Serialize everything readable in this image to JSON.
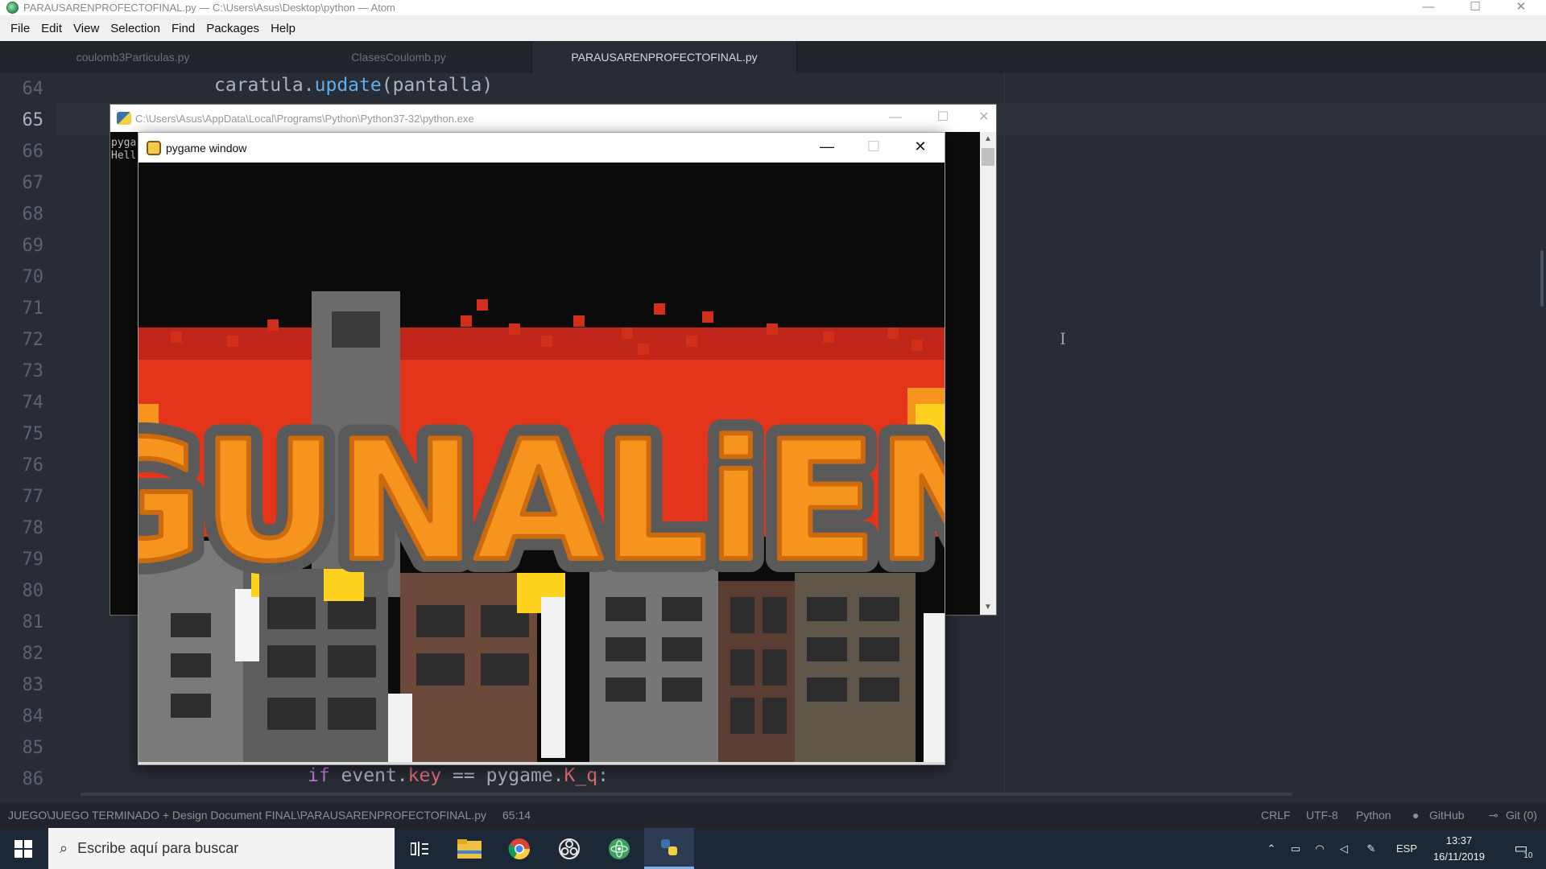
{
  "window": {
    "title": "PARAUSARENPROFECTOFINAL.py — C:\\Users\\Asus\\Desktop\\python — Atom",
    "minimize_glyph": "—",
    "maximize_glyph": "☐",
    "close_glyph": "✕"
  },
  "menu": {
    "items": [
      "File",
      "Edit",
      "View",
      "Selection",
      "Find",
      "Packages",
      "Help"
    ]
  },
  "tabs": [
    {
      "label": "coulomb3Particulas.py",
      "active": false
    },
    {
      "label": "ClasesCoulomb.py",
      "active": false
    },
    {
      "label": "PARAUSARENPROFECTOFINAL.py",
      "active": true
    }
  ],
  "editor": {
    "line_numbers": [
      "64",
      "65",
      "66",
      "67",
      "68",
      "69",
      "70",
      "71",
      "72",
      "73",
      "74",
      "75",
      "76",
      "77",
      "78",
      "79",
      "80",
      "81",
      "82",
      "83",
      "84",
      "85",
      "86"
    ],
    "current_line": "65",
    "line64": {
      "obj": "caratula.",
      "method": "update",
      "args": "(pantalla)"
    },
    "line86": {
      "kw": "if",
      "a": " event.",
      "b": "key",
      "c": " == pygame.",
      "d": "K_q",
      "e": ":"
    }
  },
  "console": {
    "title": "C:\\Users\\Asus\\AppData\\Local\\Programs\\Python\\Python37-32\\python.exe",
    "output_lines": [
      "pyga",
      "Hell"
    ],
    "minimize_glyph": "—",
    "maximize_glyph": "☐",
    "close_glyph": "✕"
  },
  "pygame_window": {
    "title": "pygame window",
    "minimize_glyph": "—",
    "maximize_glyph": "☐",
    "close_glyph": "✕",
    "logo_text": "GUNALiEN"
  },
  "status_bar": {
    "path": "JUEGO\\JUEGO TERMINADO + Design Document FINAL\\PARAUSARENPROFECTOFINAL.py",
    "cursor_position": "65:14",
    "line_ending": "CRLF",
    "encoding": "UTF-8",
    "grammar": "Python",
    "github": "GitHub",
    "git": "Git (0)"
  },
  "taskbar": {
    "search_placeholder": "Escribe aquí para buscar",
    "language": "ESP",
    "time": "13:37",
    "date": "16/11/2019",
    "notifications": "10"
  },
  "colors": {
    "editor_bg": "#282c34",
    "function": "#61afef",
    "property": "#e06c75",
    "keyword": "#c678dd",
    "logo_orange": "#f7941d",
    "fire_red": "#e4341a"
  }
}
